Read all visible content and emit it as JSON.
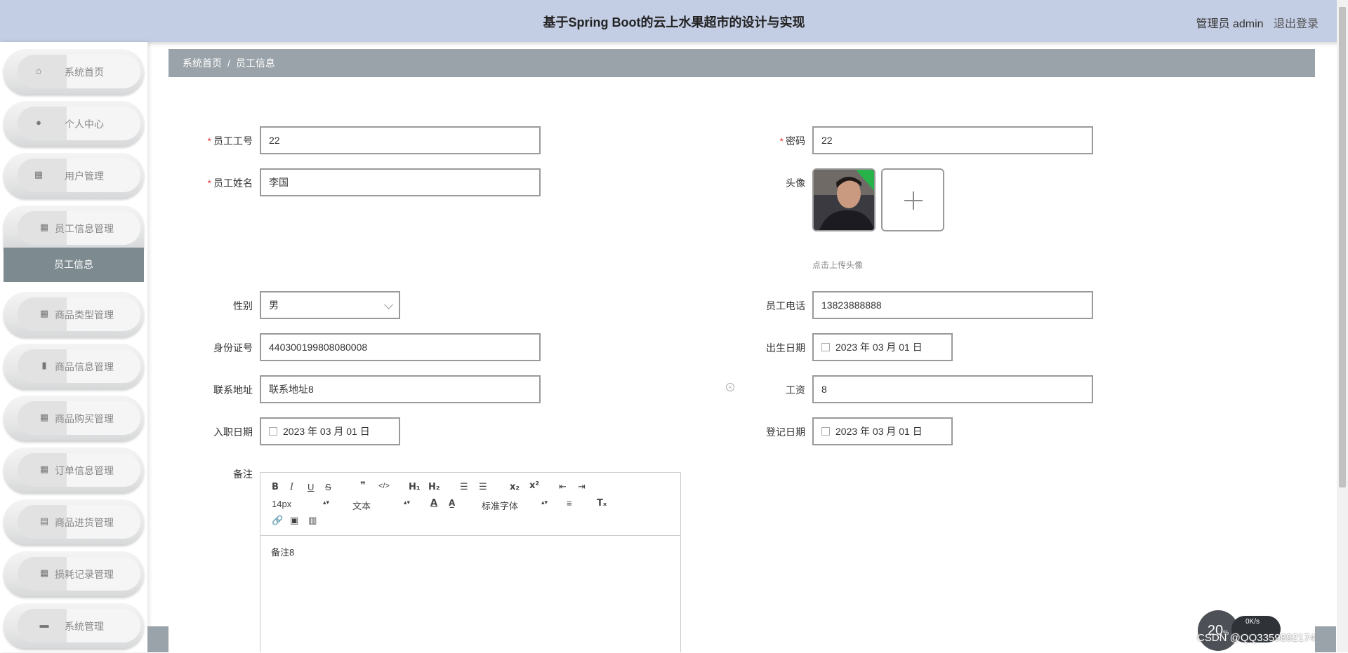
{
  "header": {
    "title": "基于Spring Boot的云上水果超市的设计与实现",
    "user": "管理员 admin",
    "logout": "退出登录"
  },
  "sidebar": {
    "items": [
      {
        "label": "系统首页",
        "icon": "home-icon"
      },
      {
        "label": "个人中心",
        "icon": "person-icon"
      },
      {
        "label": "用户管理",
        "icon": "grid-icon"
      },
      {
        "label": "员工信息管理",
        "icon": "grid-icon"
      },
      {
        "label": "商品类型管理",
        "icon": "grid-icon"
      },
      {
        "label": "商品信息管理",
        "icon": "chart-icon"
      },
      {
        "label": "商品购买管理",
        "icon": "grid-icon"
      },
      {
        "label": "订单信息管理",
        "icon": "grid-icon"
      },
      {
        "label": "商品进货管理",
        "icon": "clipboard-icon"
      },
      {
        "label": "损耗记录管理",
        "icon": "grid-icon"
      },
      {
        "label": "系统管理",
        "icon": "ticket-icon"
      }
    ],
    "submenu_active": "员工信息"
  },
  "breadcrumb": {
    "home": "系统首页",
    "separator": "/",
    "current": "员工信息"
  },
  "form": {
    "employee_no": {
      "label": "员工工号",
      "value": "22"
    },
    "password": {
      "label": "密码",
      "value": "22"
    },
    "employee_name": {
      "label": "员工姓名",
      "value": "李国"
    },
    "avatar": {
      "label": "头像",
      "hint": "点击上传头像"
    },
    "gender": {
      "label": "性别",
      "value": "男"
    },
    "phone": {
      "label": "员工电话",
      "value": "13823888888"
    },
    "id_card": {
      "label": "身份证号",
      "value": "440300199808080008"
    },
    "birth_date": {
      "label": "出生日期",
      "value": "2023 年 03 月 01 日"
    },
    "address": {
      "label": "联系地址",
      "value": "联系地址8"
    },
    "salary": {
      "label": "工资",
      "value": "8"
    },
    "entry_date": {
      "label": "入职日期",
      "value": "2023 年 03 月 01 日"
    },
    "register_date": {
      "label": "登记日期",
      "value": "2023 年 03 月 01 日"
    },
    "remark": {
      "label": "备注",
      "value": "备注8"
    }
  },
  "editor": {
    "font_size": "14px",
    "text_style": "文本",
    "font_family": "标准字体"
  },
  "net_widget": {
    "percent": "20",
    "speed": "0K/s"
  },
  "watermark": "CSDN @QQ3359892174",
  "colors": {
    "topbar": "#c3cde3",
    "breadcrumb": "#9aa3a9",
    "submenu_active": "#7d8b91",
    "required": "#e64242"
  }
}
